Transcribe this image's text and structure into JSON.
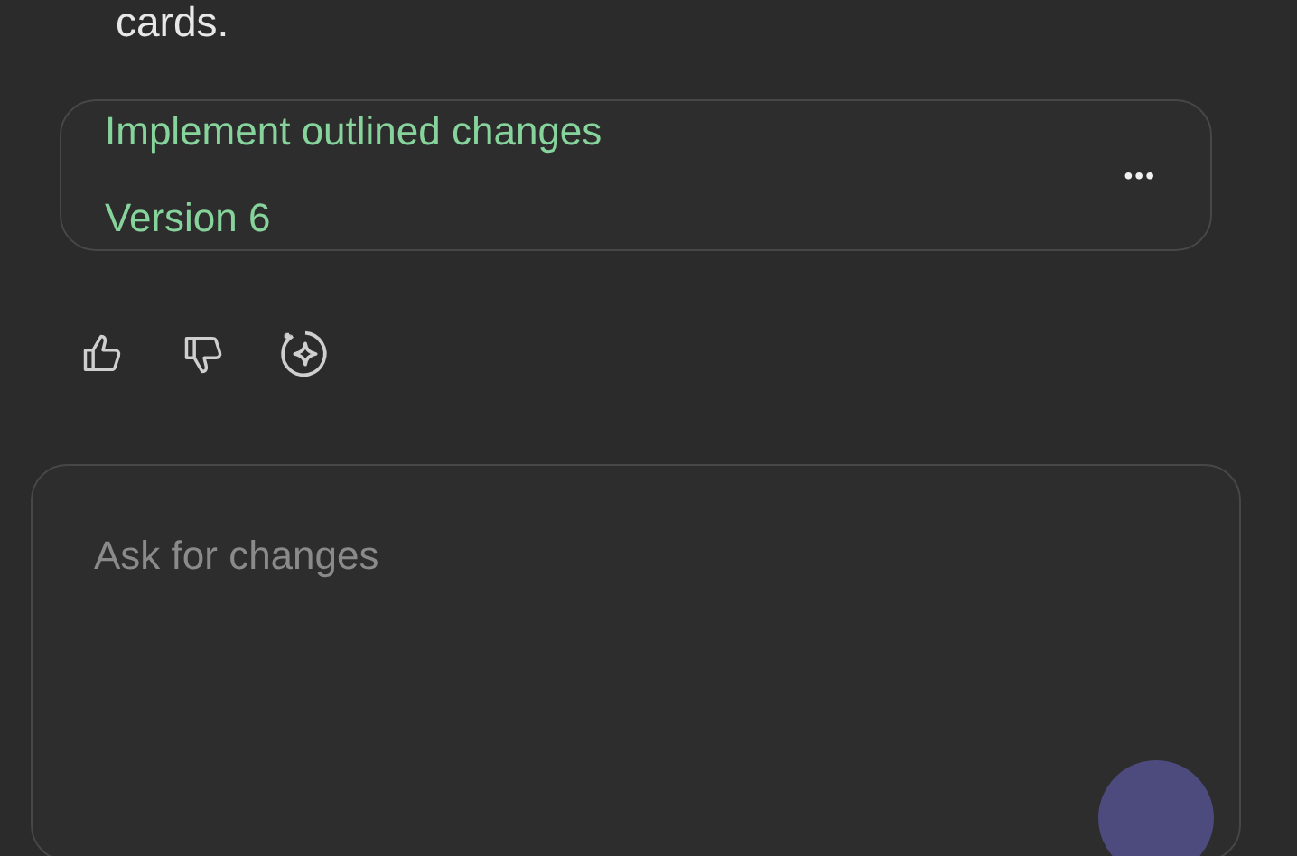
{
  "message": {
    "text": "cards."
  },
  "artifact_card": {
    "title": "Implement outlined changes",
    "version": "Version 6",
    "menu_label": "•••"
  },
  "feedback_actions": [
    {
      "kind": "thumbs_up"
    },
    {
      "kind": "thumbs_down"
    },
    {
      "kind": "sparkle"
    }
  ],
  "composer": {
    "placeholder": "Ask for changes"
  }
}
